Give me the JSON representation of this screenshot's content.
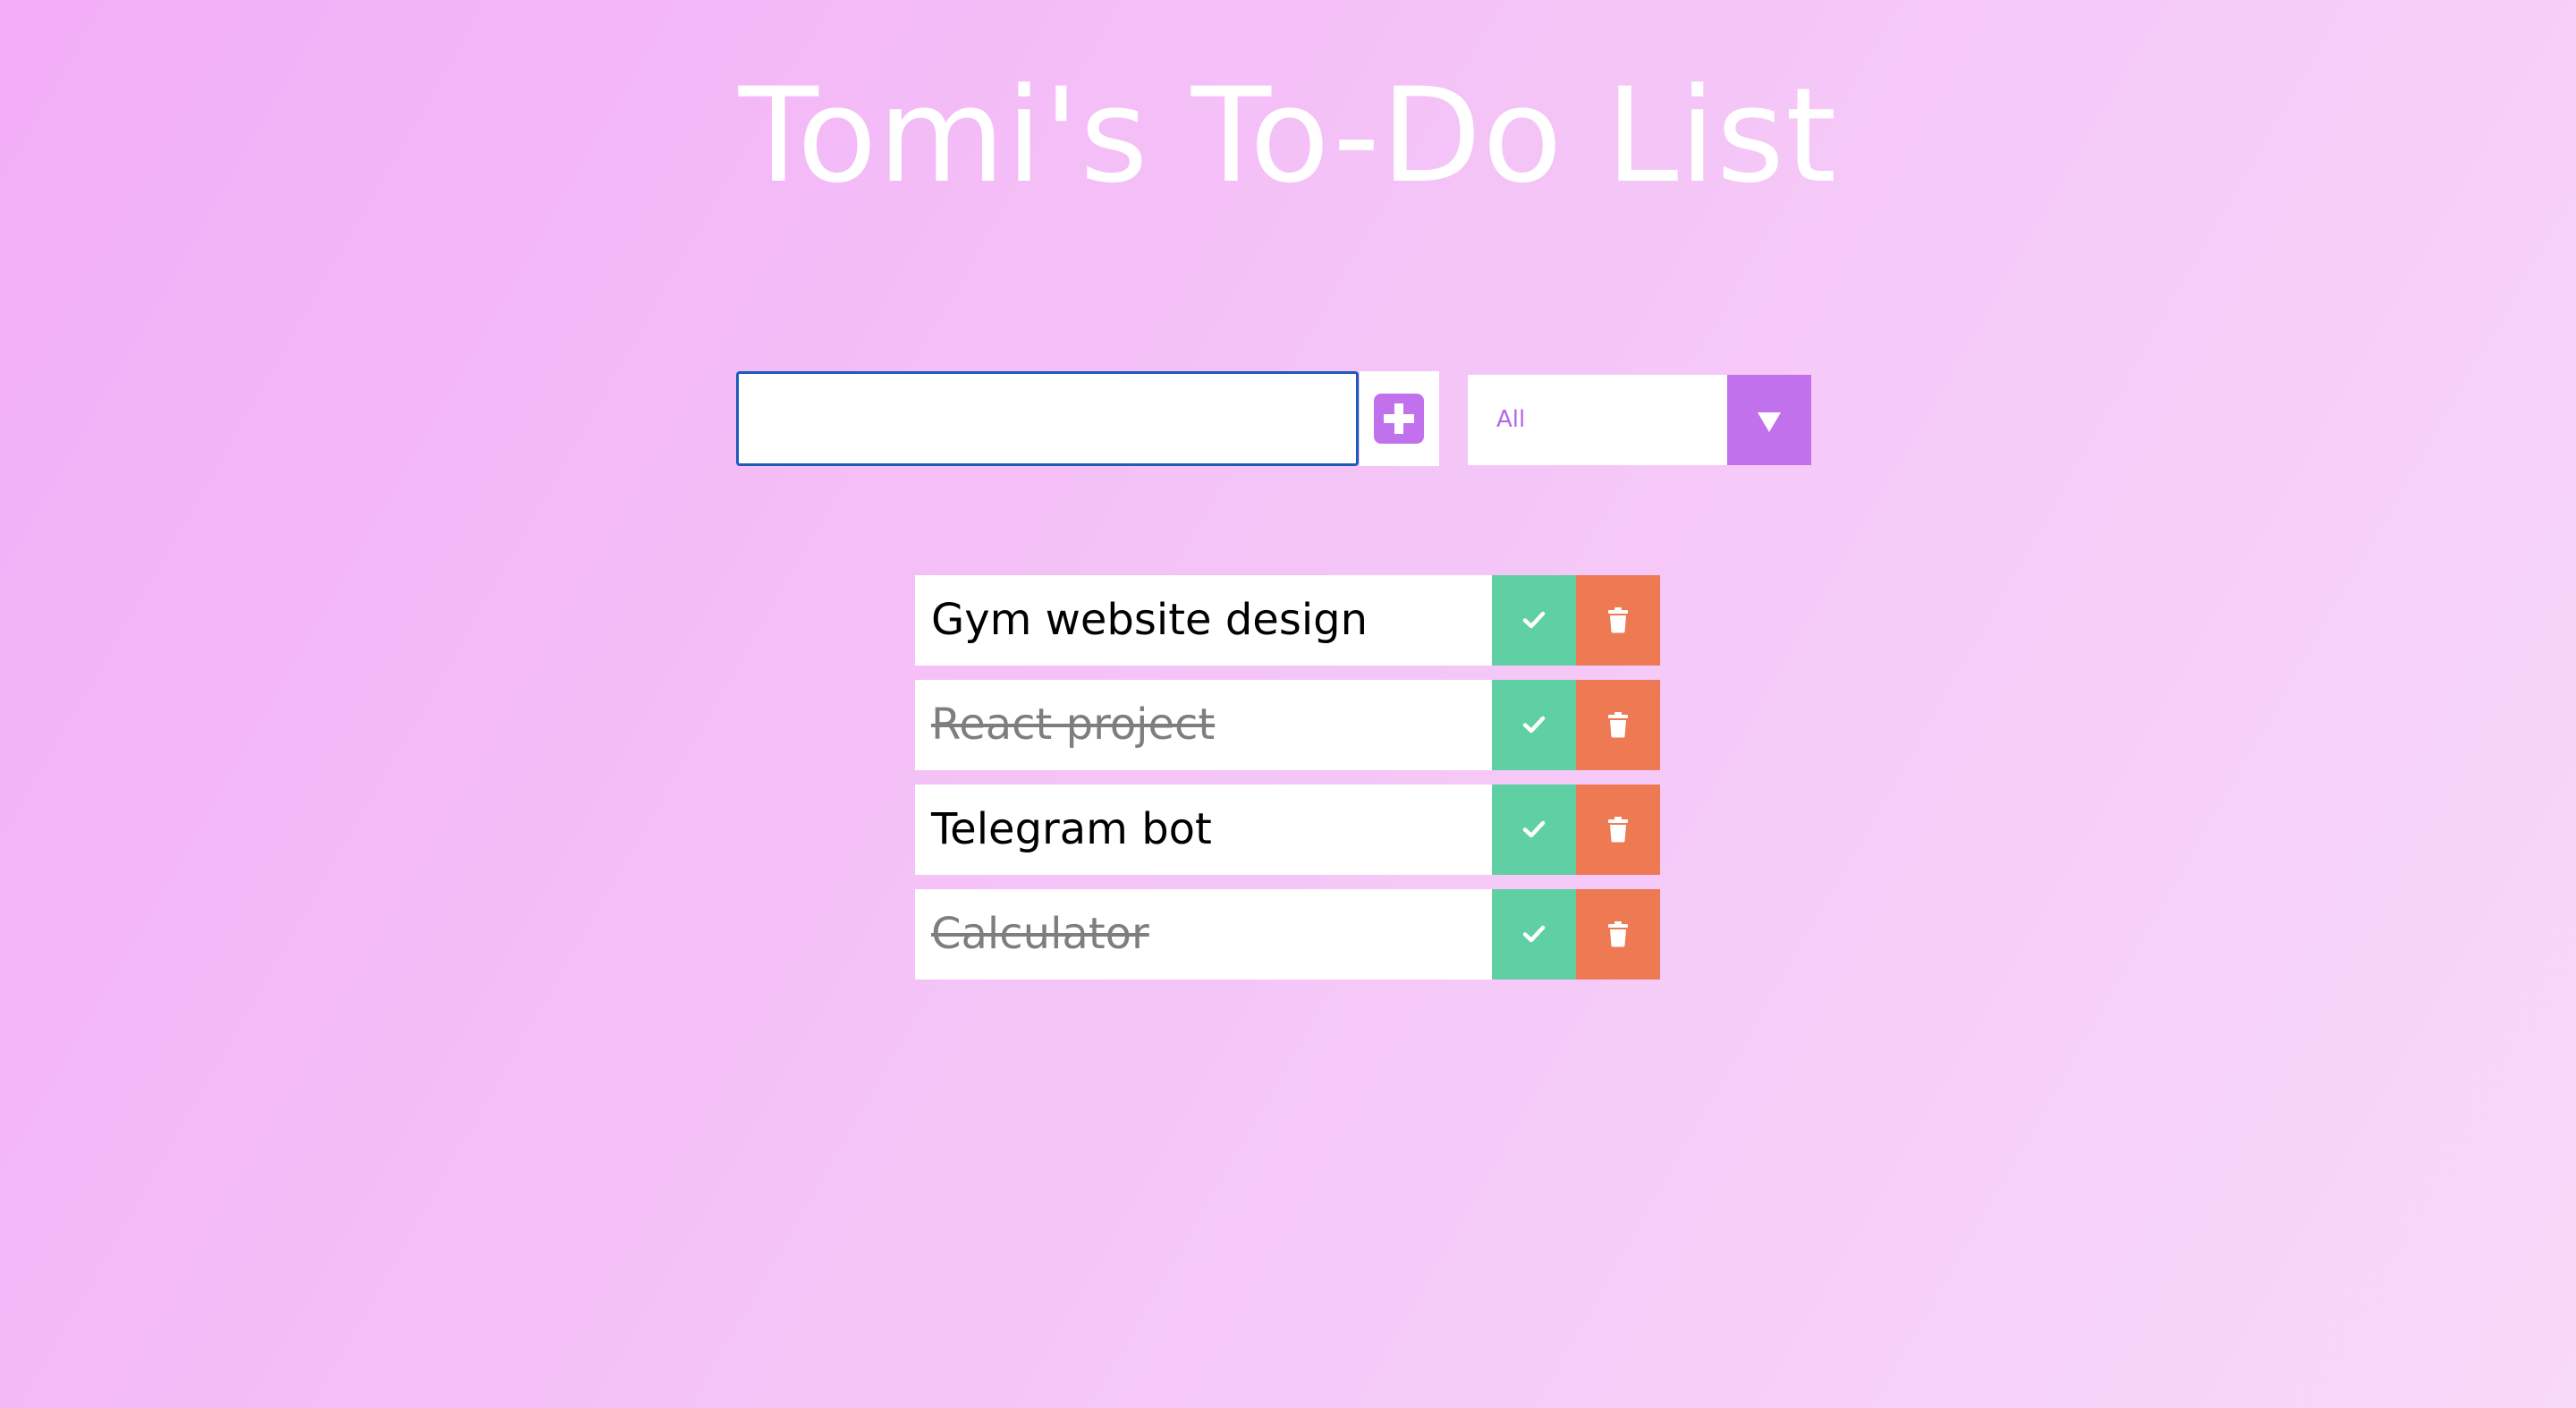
{
  "header": {
    "title": "Tomi's To-Do List"
  },
  "form": {
    "input_value": "",
    "add_icon": "plus-square-icon",
    "filter": {
      "selected": "All",
      "arrow_icon": "caret-down-icon"
    }
  },
  "todos": [
    {
      "text": "Gym website design",
      "completed": false
    },
    {
      "text": "React project",
      "completed": true
    },
    {
      "text": "Telegram bot",
      "completed": false
    },
    {
      "text": "Calculator",
      "completed": true
    }
  ],
  "item_actions": {
    "complete_icon": "check-icon",
    "delete_icon": "trash-icon"
  },
  "colors": {
    "accent": "#c271ed",
    "complete": "#5ed0a4",
    "delete": "#ee7a54",
    "input_border": "#1c5bb8"
  }
}
